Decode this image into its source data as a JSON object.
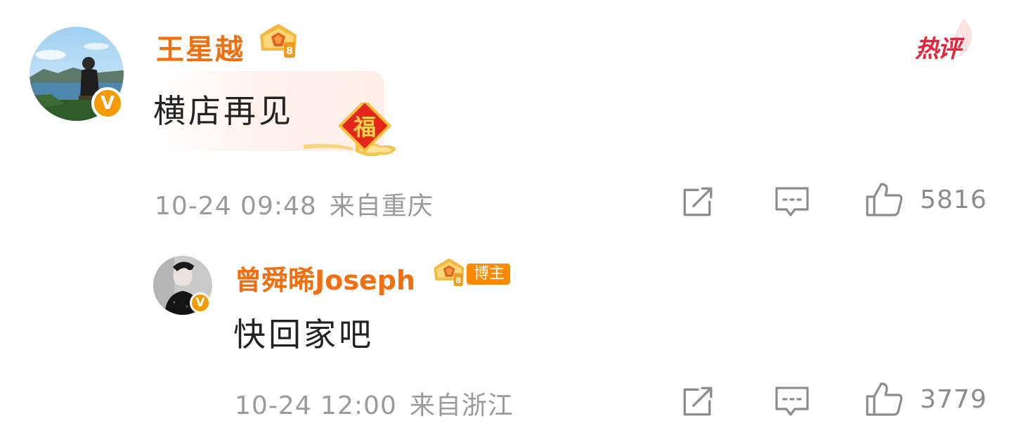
{
  "comments": [
    {
      "username": "王星越",
      "text": "横店再见",
      "time": "10-24 09:48",
      "location": "来自重庆",
      "likes": "5816",
      "verified_badge": "V",
      "hot_label": "热评"
    },
    {
      "username": "曾舜晞Joseph",
      "text": "快回家吧",
      "time": "10-24 12:00",
      "location": "来自浙江",
      "likes": "3779",
      "verified_badge": "V",
      "role_tag": "博主"
    }
  ],
  "icons": {
    "share": "share-edit-icon",
    "comment": "comment-bubble-icon",
    "like": "thumbs-up-icon",
    "crown": "crown-badge-icon",
    "fu": "fu-blessing-icon"
  },
  "colors": {
    "username": "#f26e0f",
    "meta": "#9a9a9a",
    "verified": "#f59a00",
    "hot": "#e8233a",
    "role_tag": "#ff8a00"
  }
}
